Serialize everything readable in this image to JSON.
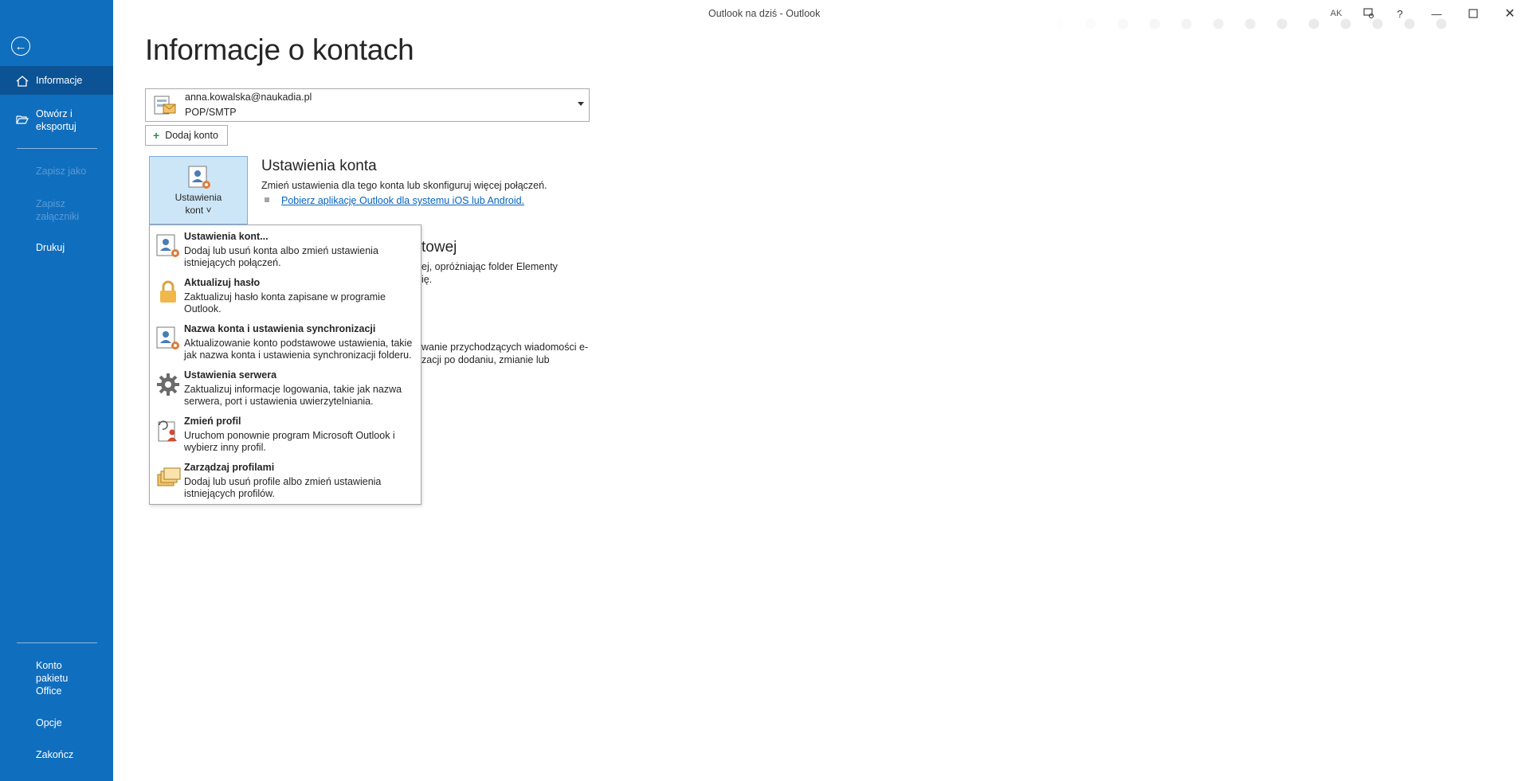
{
  "window": {
    "title": "Outlook na dziś  -  Outlook",
    "avatar_initials": "AK"
  },
  "nav": {
    "back_label": "",
    "items": [
      {
        "label": "Informacje"
      },
      {
        "label": "Otwórz i eksportuj"
      },
      {
        "label": "Zapisz jako"
      },
      {
        "label": "Zapisz załączniki"
      },
      {
        "label": "Drukuj"
      },
      {
        "label": "Konto pakietu Office"
      },
      {
        "label": "Opcje"
      },
      {
        "label": "Zakończ"
      }
    ]
  },
  "main": {
    "title": "Informacje o kontach",
    "account": {
      "email": "anna.kowalska@naukadia.pl",
      "type": "POP/SMTP"
    },
    "add_account_label": "Dodaj konto",
    "settings_button": {
      "line1": "Ustawienia",
      "line2": "kont ˅"
    },
    "account_settings": {
      "title": "Ustawienia konta",
      "description": "Zmień ustawienia dla tego konta lub skonfiguruj więcej połączeń.",
      "link": "Pobierz aplikację Outlook dla systemu iOS lub Android."
    },
    "partial_mailbox": {
      "title_tail": "towej",
      "line1": "ej, opróżniając folder Elementy",
      "line2": "ię."
    },
    "partial_rules": {
      "line1": "wanie przychodzących wiadomości e-",
      "line2": "zacji po dodaniu, zmianie lub"
    }
  },
  "menu": {
    "items": [
      {
        "title": "Ustawienia kont...",
        "desc": "Dodaj lub usuń konta albo zmień ustawienia istniejących połączeń.",
        "icon": "account-settings-icon"
      },
      {
        "title": "Aktualizuj hasło",
        "desc": "Zaktualizuj hasło konta zapisane w programie Outlook.",
        "icon": "lock-icon"
      },
      {
        "title": "Nazwa konta i ustawienia synchronizacji",
        "desc": "Aktualizowanie konto podstawowe ustawienia, takie jak nazwa konta i ustawienia synchronizacji folderu.",
        "icon": "account-sync-icon"
      },
      {
        "title": "Ustawienia serwera",
        "desc": "Zaktualizuj informacje logowania, takie jak nazwa serwera, port i ustawienia uwierzytelniania.",
        "icon": "gear-icon"
      },
      {
        "title": "Zmień profil",
        "desc": "Uruchom ponownie program Microsoft Outlook i wybierz inny profil.",
        "icon": "change-profile-icon"
      },
      {
        "title": "Zarządzaj profilami",
        "desc": "Dodaj lub usuń profile albo zmień ustawienia istniejących profilów.",
        "icon": "manage-profiles-icon"
      }
    ]
  },
  "colors": {
    "nav_bg": "#106ebe",
    "nav_active": "#0b5394",
    "link": "#0563c1",
    "selected_button_bg": "#cde6f7"
  }
}
